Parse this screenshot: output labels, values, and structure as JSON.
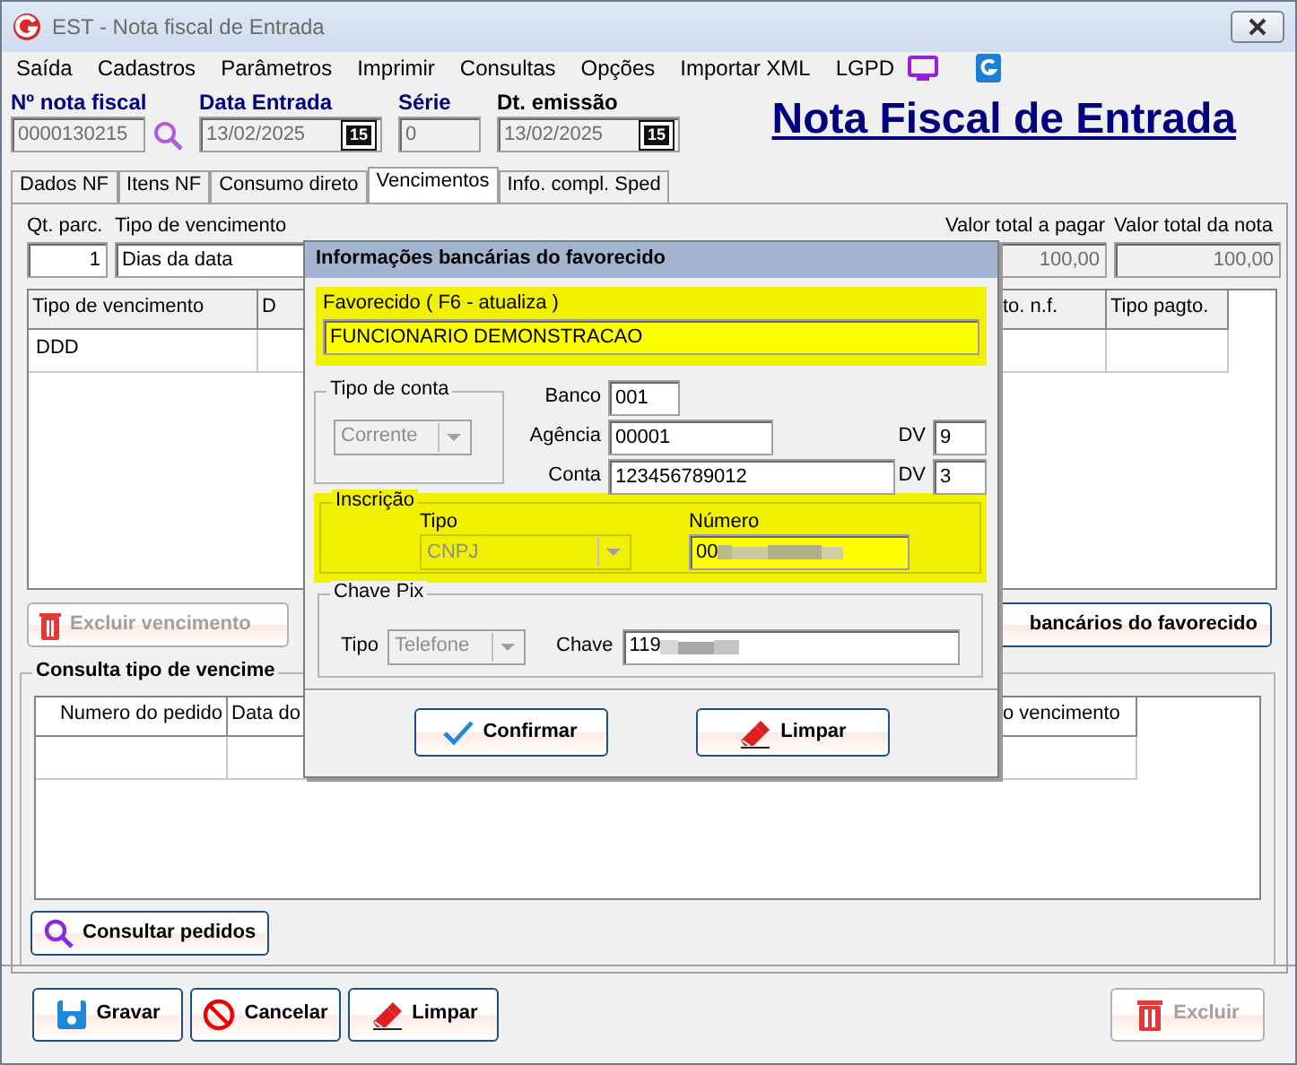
{
  "window": {
    "title": "EST - Nota fiscal de Entrada"
  },
  "menu": [
    {
      "label": "Saída"
    },
    {
      "label": "Cadastros"
    },
    {
      "label": "Parâmetros"
    },
    {
      "label": "Imprimir"
    },
    {
      "label": "Consultas"
    },
    {
      "label": "Opções"
    },
    {
      "label": "Importar XML"
    },
    {
      "label": "LGPD"
    }
  ],
  "header_fields": [
    {
      "label": "Nº nota fiscal",
      "value": "0000130215",
      "kind": "search",
      "emphasis": true
    },
    {
      "label": "Data Entrada",
      "value": "13/02/2025",
      "kind": "date",
      "calendar": "15",
      "emphasis": true
    },
    {
      "label": "Série",
      "value": "0",
      "kind": "plain",
      "emphasis": true
    },
    {
      "label": "Dt. emissão",
      "value": "13/02/2025",
      "kind": "date",
      "calendar": "15",
      "emphasis": false
    }
  ],
  "page_title": "Nota Fiscal de Entrada",
  "tabs": [
    {
      "label": "Dados NF",
      "selected": false
    },
    {
      "label": "Itens NF",
      "selected": false
    },
    {
      "label": "Consumo direto",
      "selected": false
    },
    {
      "label": "Vencimentos",
      "selected": true
    },
    {
      "label": "Info. compl. Sped",
      "selected": false
    }
  ],
  "summary": {
    "quantity_label": "Qt. parc.",
    "quantity": "1",
    "type_label": "Tipo de vencimento",
    "type_value": "Dias da data",
    "total_pay_label": "Valor total a pagar",
    "total_pay": "100,00",
    "total_note_label": "Valor total da nota",
    "total_note": "100,00"
  },
  "installments_grid": {
    "columns": [
      "Tipo de vencimento",
      "D",
      "to. n.f.",
      "Tipo pagto."
    ],
    "rows": [
      [
        "DDD"
      ]
    ]
  },
  "delete_installment_button": {
    "label": "Excluir vencimento",
    "disabled": true
  },
  "bank_info_button": {
    "label": "bancários do favorecido",
    "disabled": false
  },
  "orders": {
    "title": "Consulta tipo de vencime",
    "columns": [
      "Numero do pedido",
      "Data do",
      "o vencimento"
    ],
    "search_button": "Consultar pedidos"
  },
  "footer_buttons": [
    {
      "label": "Gravar",
      "kind": "save",
      "disabled": false
    },
    {
      "label": "Cancelar",
      "kind": "cancel",
      "disabled": false
    },
    {
      "label": "Limpar",
      "kind": "eraser",
      "disabled": false
    },
    {
      "label": "Excluir",
      "kind": "trash",
      "disabled": true
    }
  ],
  "dialog": {
    "title": "Informações bancárias do favorecido",
    "payee_label": "Favorecido ( F6 - atualiza )",
    "payee": "FUNCIONARIO DEMONSTRACAO",
    "account_type_title": "Tipo de conta",
    "account_type": {
      "value": "Corrente",
      "disabled": true
    },
    "bank_label": "Banco",
    "bank": "001",
    "branch_label": "Agência",
    "branch": "00001",
    "branch_dv_label": "DV",
    "branch_dv": "9",
    "account_label": "Conta",
    "account": "123456789012",
    "account_dv_label": "DV",
    "account_dv": "3",
    "registration_title": "Inscrição",
    "registration_type_label": "Tipo",
    "registration_type": {
      "value": "CNPJ",
      "disabled": true
    },
    "registration_number_label": "Número",
    "registration_number": "00",
    "pix_title": "Chave Pix",
    "pix_type_label": "Tipo",
    "pix_type": {
      "value": "Telefone",
      "disabled": true
    },
    "pix_key_label": "Chave",
    "pix_key": "119",
    "buttons": [
      {
        "label": "Confirmar",
        "kind": "check"
      },
      {
        "label": "Limpar",
        "kind": "eraser"
      }
    ]
  }
}
